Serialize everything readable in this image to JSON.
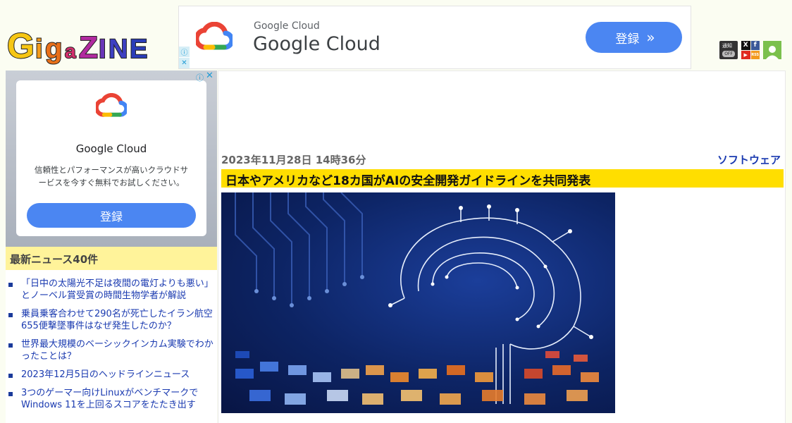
{
  "site": {
    "logo_text": "Gigazine"
  },
  "top_ad": {
    "brand_small": "Google Cloud",
    "brand_big": "Google Cloud",
    "button_label": "登録",
    "button_chevron": "»",
    "adchoices_icon": "info-icon",
    "close_icon": "✕"
  },
  "header_icons": {
    "notify_label": "通知",
    "notify_state": "OFF",
    "social": [
      "X",
      "f",
      "▶",
      "RSS"
    ]
  },
  "side_ad": {
    "title": "Google Cloud",
    "description": "信頼性とパフォーマンスが高いクラウドサービスを今すぐ無料でお試しください。",
    "button_label": "登録",
    "info_icon": "ⓘ",
    "close_icon": "✕"
  },
  "news": {
    "heading": "最新ニュース40件",
    "items": [
      "「日中の太陽光不足は夜間の電灯よりも悪い」とノーベル賞受賞の時間生物学者が解説",
      "乗員乗客合わせて290名が死亡したイラン航空655便撃墜事件はなぜ発生したのか？",
      "世界最大規模のベーシックインカム実験でわかったことは？",
      "2023年12月5日のヘッドラインニュース",
      "3つのゲーマー向けLinuxがベンチマークでWindows 11を上回るスコアをたたき出す"
    ]
  },
  "article": {
    "date": "2023年11月28日 14時36分",
    "category": "ソフトウェア",
    "title": "日本やアメリカなど18カ国がAIの安全開発ガイドラインを共同発表"
  },
  "colors": {
    "ad_blue": "#4b86f2",
    "title_bar": "#ffde00",
    "news_header": "#fff39a",
    "link": "#1a3ab0"
  }
}
